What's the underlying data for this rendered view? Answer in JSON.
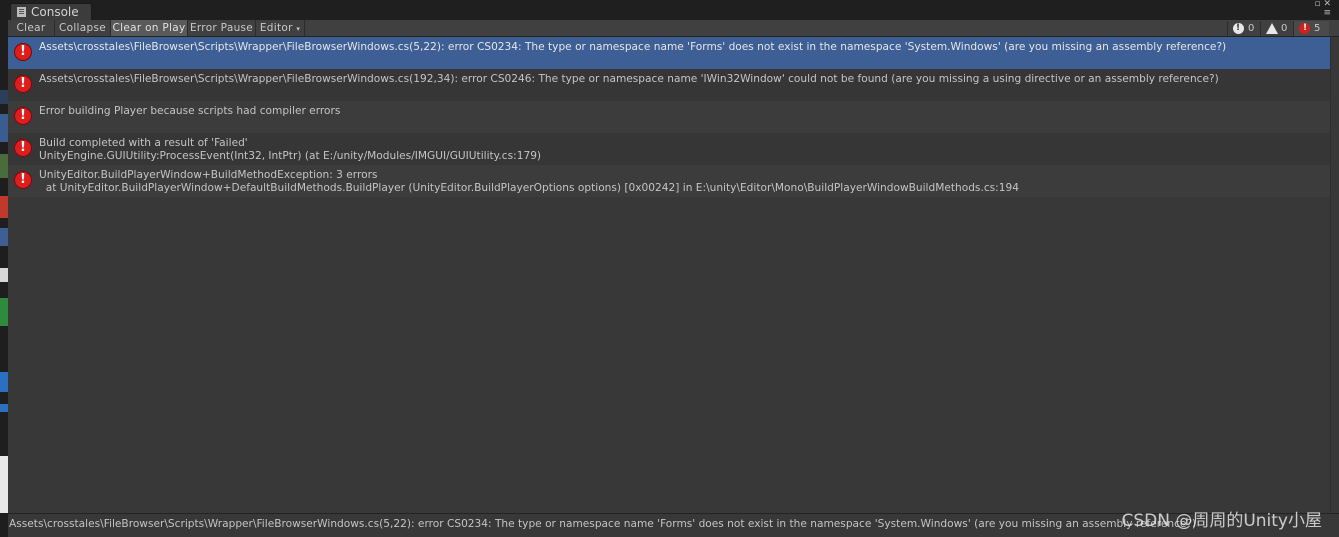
{
  "tab": {
    "title": "Console"
  },
  "toolbar": {
    "clear": "Clear",
    "collapse": "Collapse",
    "clear_on_play": "Clear on Play",
    "error_pause": "Error Pause",
    "editor": "Editor",
    "info_count": "0",
    "warning_count": "0",
    "error_count": "5"
  },
  "logs": [
    {
      "line1": "Assets\\crosstales\\FileBrowser\\Scripts\\Wrapper\\FileBrowserWindows.cs(5,22): error CS0234: The type or namespace name 'Forms' does not exist in the namespace 'System.Windows' (are you missing an assembly reference?)",
      "line2": "",
      "selected": true
    },
    {
      "line1": "Assets\\crosstales\\FileBrowser\\Scripts\\Wrapper\\FileBrowserWindows.cs(192,34): error CS0246: The type or namespace name 'IWin32Window' could not be found (are you missing a using directive or an assembly reference?)",
      "line2": ""
    },
    {
      "line1": "Error building Player because scripts had compiler errors",
      "line2": ""
    },
    {
      "line1": "Build completed with a result of 'Failed'",
      "line2": "UnityEngine.GUIUtility:ProcessEvent(Int32, IntPtr) (at E:/unity/Modules/IMGUI/GUIUtility.cs:179)"
    },
    {
      "line1": "UnityEditor.BuildPlayerWindow+BuildMethodException: 3 errors",
      "line2": "  at UnityEditor.BuildPlayerWindow+DefaultBuildMethods.BuildPlayer (UnityEditor.BuildPlayerOptions options) [0x00242] in E:\\unity\\Editor\\Mono\\BuildPlayerWindowBuildMethods.cs:194"
    }
  ],
  "detail": {
    "text": "Assets\\crosstales\\FileBrowser\\Scripts\\Wrapper\\FileBrowserWindows.cs(5,22): error CS0234: The type or namespace name 'Forms' does not exist in the namespace 'System.Windows' (are you missing an assembly reference?)"
  },
  "watermark": "CSDN @周周的Unity小屋",
  "colors": {
    "selected_row": "#3e5f96",
    "error_icon": "#e01d1d",
    "panel_bg": "#383838"
  }
}
